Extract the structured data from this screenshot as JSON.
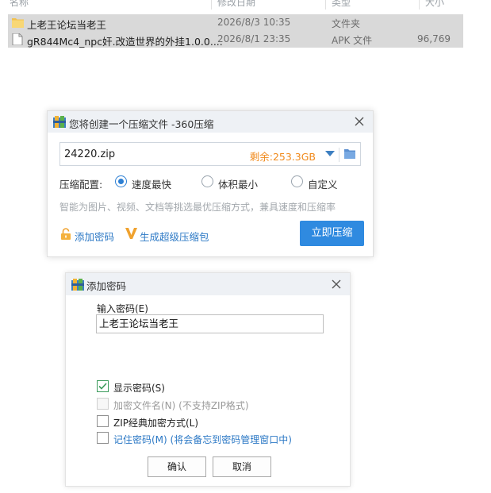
{
  "explorer": {
    "columns": {
      "name": "名称",
      "date": "修改日期",
      "type": "类型",
      "size": "大小"
    },
    "files": [
      {
        "name": "上老王论坛当老王",
        "date": "2026/8/3 10:35",
        "type": "文件夹",
        "size": "",
        "icon": "folder-icon"
      },
      {
        "name": "gR844Mc4_npc奸.改造世界的外挂1.0.0....",
        "date": "2026/8/1 23:35",
        "type": "APK 文件",
        "size": "96,769",
        "icon": "apk-file-icon"
      }
    ]
  },
  "compress_dialog": {
    "title": "您将创建一个压缩文件 -360压缩",
    "filename": "24220.zip",
    "remaining": "剩余:253.3GB",
    "config_label": "压缩配置:",
    "options": [
      {
        "label": "速度最快",
        "selected": true
      },
      {
        "label": "体积最小",
        "selected": false
      },
      {
        "label": "自定义",
        "selected": false
      }
    ],
    "hint": "智能为图片、视频、文档等挑选最优压缩方式，兼具速度和压缩率",
    "add_password": "添加密码",
    "super_pack": "生成超级压缩包",
    "compress_button": "立即压缩",
    "accent_color": "#2f8ae0"
  },
  "password_dialog": {
    "title": "添加密码",
    "input_label": "输入密码(E)",
    "password_value": "上老王论坛当老王",
    "checkboxes": [
      {
        "label": "显示密码(S)",
        "note": "",
        "checked": true,
        "disabled": false
      },
      {
        "label": "加密文件名(N)",
        "note": " (不支持ZIP格式)",
        "checked": false,
        "disabled": true
      },
      {
        "label": "ZIP经典加密方式(L)",
        "note": "",
        "checked": false,
        "disabled": false
      },
      {
        "label": "记住密码(M)",
        "note": " (将会备忘到密码管理窗口中)",
        "checked": false,
        "disabled": false
      }
    ],
    "ok_button": "确认",
    "cancel_button": "取消"
  }
}
